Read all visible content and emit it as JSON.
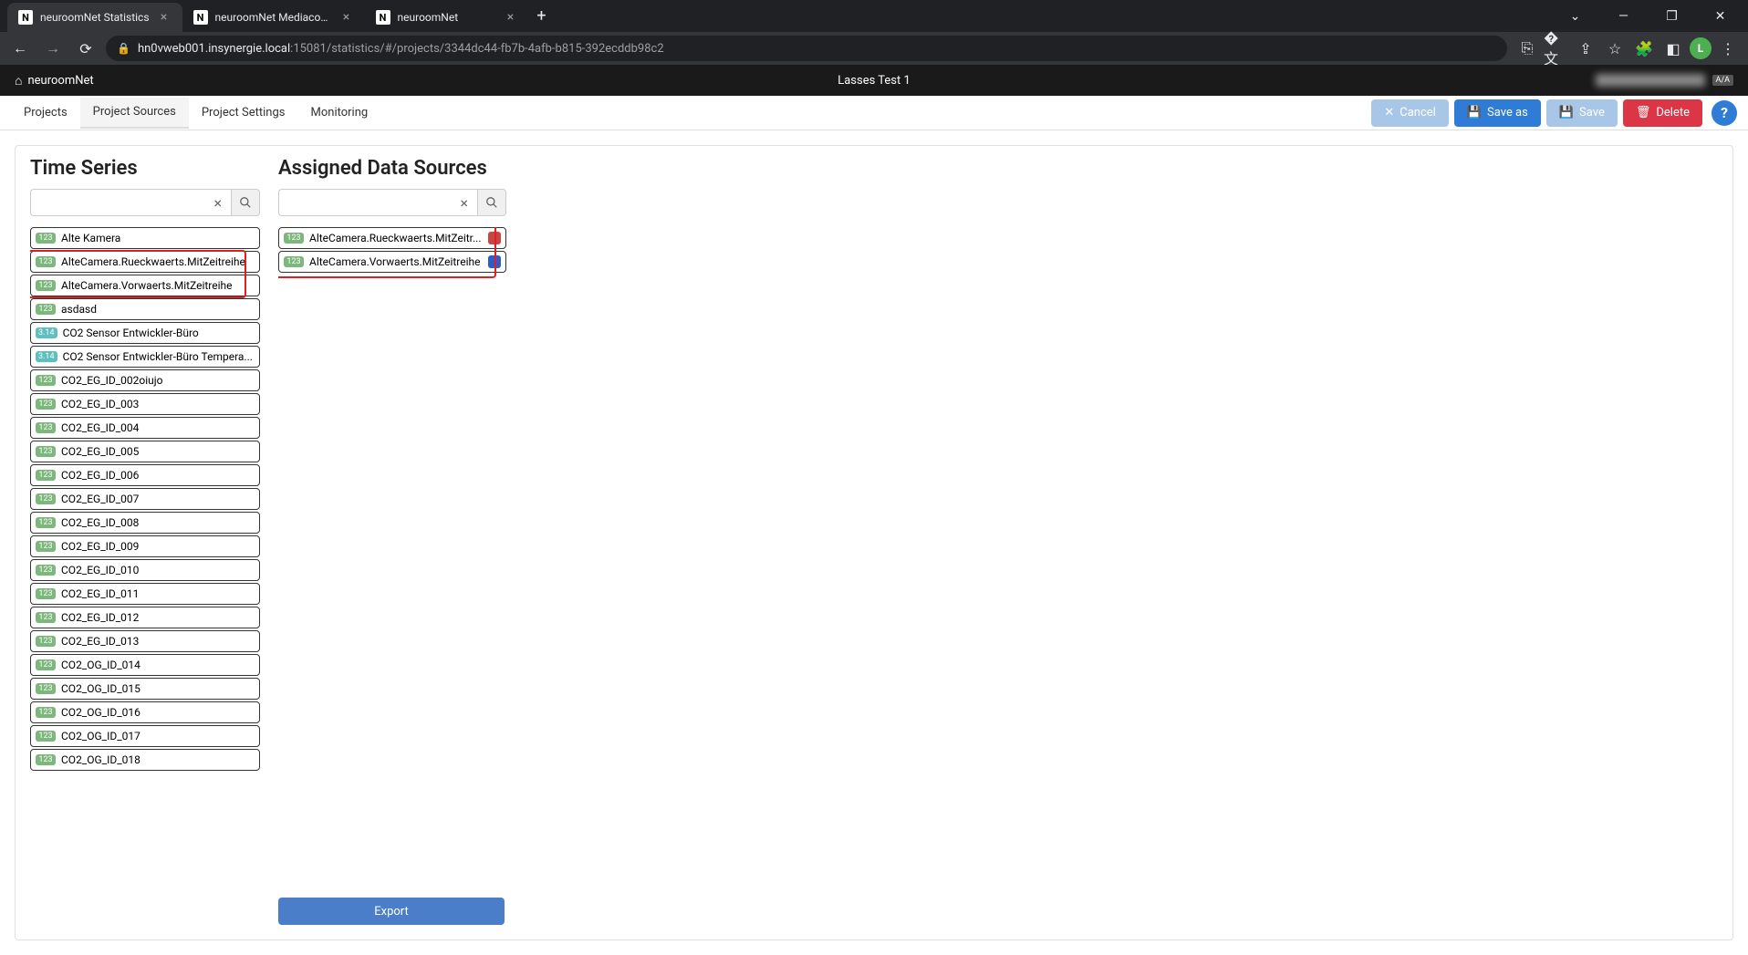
{
  "browser": {
    "tabs": [
      {
        "title": "neuroomNet Statistics",
        "active": true
      },
      {
        "title": "neuroomNet Mediacontrol",
        "active": false
      },
      {
        "title": "neuroomNet",
        "active": false
      }
    ],
    "url_host": "hn0vweb001.insynergie.local",
    "url_port": ":15081",
    "url_path": "/statistics/#/projects/3344dc44-fb7b-4afb-b815-392ecddb98c2",
    "profile_initial": "L"
  },
  "app_header": {
    "brand": "neuroomNet",
    "title": "Lasses Test 1",
    "lang": "A/A"
  },
  "toolbar": {
    "tabs": [
      {
        "label": "Projects",
        "active": false
      },
      {
        "label": "Project Sources",
        "active": true
      },
      {
        "label": "Project Settings",
        "active": false
      },
      {
        "label": "Monitoring",
        "active": false
      }
    ],
    "cancel": "Cancel",
    "save_as": "Save as",
    "save": "Save",
    "delete": "Delete",
    "help": "?"
  },
  "panels": {
    "time_series_title": "Time Series",
    "assigned_title": "Assigned Data Sources",
    "export": "Export"
  },
  "time_series": [
    {
      "badge": "123",
      "badge_type": "123",
      "label": "Alte Kamera"
    },
    {
      "badge": "123",
      "badge_type": "123",
      "label": "AlteCamera.Rueckwaerts.MitZeitreihe"
    },
    {
      "badge": "123",
      "badge_type": "123",
      "label": "AlteCamera.Vorwaerts.MitZeitreihe"
    },
    {
      "badge": "123",
      "badge_type": "123",
      "label": "asdasd"
    },
    {
      "badge": "3.14",
      "badge_type": "314",
      "label": "CO2 Sensor Entwickler-Büro"
    },
    {
      "badge": "3.14",
      "badge_type": "314",
      "label": "CO2 Sensor Entwickler-Büro Tempera..."
    },
    {
      "badge": "123",
      "badge_type": "123",
      "label": "CO2_EG_ID_002oiujo"
    },
    {
      "badge": "123",
      "badge_type": "123",
      "label": "CO2_EG_ID_003"
    },
    {
      "badge": "123",
      "badge_type": "123",
      "label": "CO2_EG_ID_004"
    },
    {
      "badge": "123",
      "badge_type": "123",
      "label": "CO2_EG_ID_005"
    },
    {
      "badge": "123",
      "badge_type": "123",
      "label": "CO2_EG_ID_006"
    },
    {
      "badge": "123",
      "badge_type": "123",
      "label": "CO2_EG_ID_007"
    },
    {
      "badge": "123",
      "badge_type": "123",
      "label": "CO2_EG_ID_008"
    },
    {
      "badge": "123",
      "badge_type": "123",
      "label": "CO2_EG_ID_009"
    },
    {
      "badge": "123",
      "badge_type": "123",
      "label": "CO2_EG_ID_010"
    },
    {
      "badge": "123",
      "badge_type": "123",
      "label": "CO2_EG_ID_011"
    },
    {
      "badge": "123",
      "badge_type": "123",
      "label": "CO2_EG_ID_012"
    },
    {
      "badge": "123",
      "badge_type": "123",
      "label": "CO2_EG_ID_013"
    },
    {
      "badge": "123",
      "badge_type": "123",
      "label": "CO2_OG_ID_014"
    },
    {
      "badge": "123",
      "badge_type": "123",
      "label": "CO2_OG_ID_015"
    },
    {
      "badge": "123",
      "badge_type": "123",
      "label": "CO2_OG_ID_016"
    },
    {
      "badge": "123",
      "badge_type": "123",
      "label": "CO2_OG_ID_017"
    },
    {
      "badge": "123",
      "badge_type": "123",
      "label": "CO2_OG_ID_018"
    }
  ],
  "assigned": [
    {
      "badge": "123",
      "badge_type": "123",
      "label": "AlteCamera.Rueckwaerts.MitZeitr...",
      "color": "#c94444"
    },
    {
      "badge": "123",
      "badge_type": "123",
      "label": "AlteCamera.Vorwaerts.MitZeitreihe",
      "color": "#2e5cc9"
    }
  ]
}
